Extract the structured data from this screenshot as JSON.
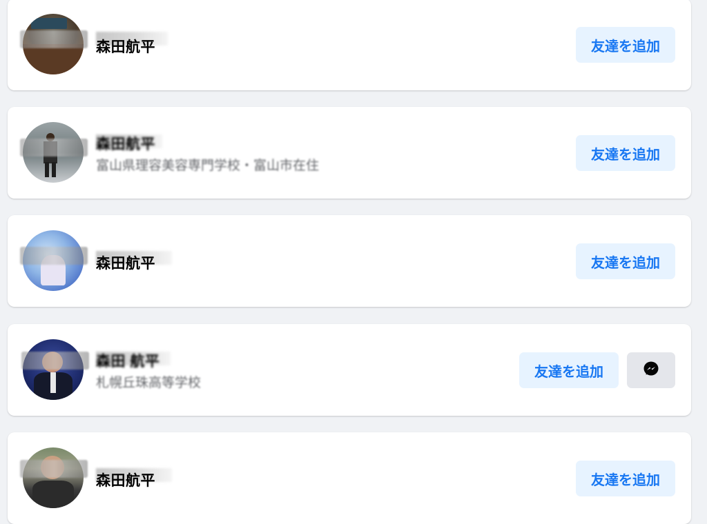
{
  "friend_suggestions": [
    {
      "name": "森田航平",
      "subtitle": "",
      "add_label": "友達を追加",
      "has_messenger": false
    },
    {
      "name": "森田航平",
      "subtitle": "富山県理容美容専門学校・富山市在住",
      "add_label": "友達を追加",
      "has_messenger": false
    },
    {
      "name": "森田航平",
      "subtitle": "",
      "add_label": "友達を追加",
      "has_messenger": false
    },
    {
      "name": "森田 航平",
      "subtitle": "札幌丘珠高等学校",
      "add_label": "友達を追加",
      "has_messenger": true,
      "messenger_icon": "messenger-icon"
    },
    {
      "name": "森田航平",
      "subtitle": "",
      "add_label": "友達を追加",
      "has_messenger": false
    }
  ],
  "colors": {
    "page_background": "#f0f2f5",
    "card_background": "#ffffff",
    "add_button_background": "#e7f3ff",
    "add_button_text": "#1877f2",
    "messenger_button_background": "#e4e6eb"
  }
}
